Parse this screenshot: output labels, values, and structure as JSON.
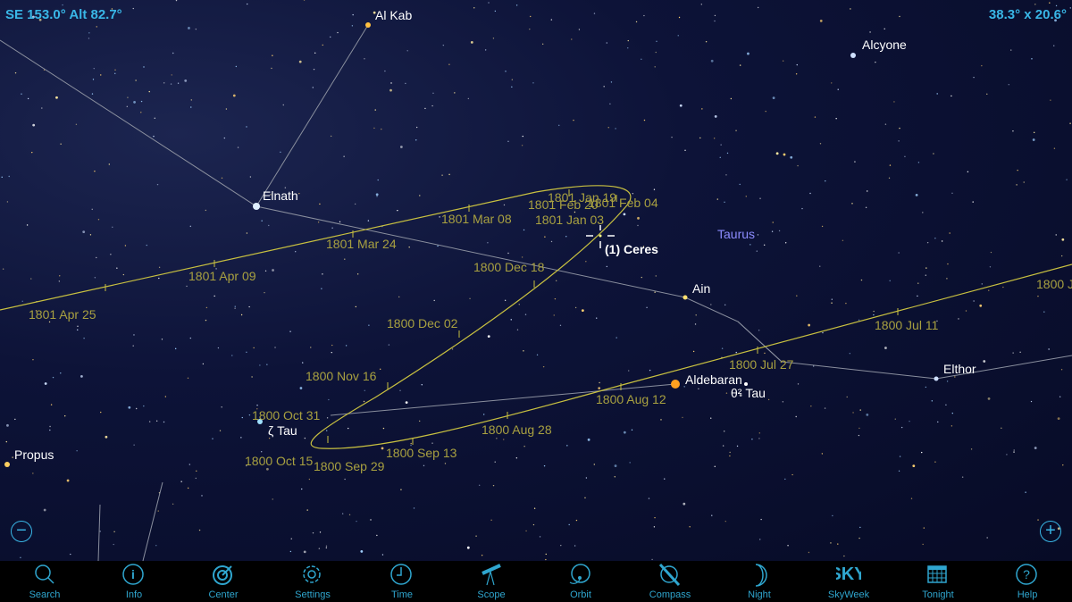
{
  "hud": {
    "direction": "SE 153.0° Alt 82.7°",
    "fov": "38.3° x 20.6°"
  },
  "colors": {
    "accent": "#39b6e6",
    "path": "#c8c040",
    "date_label": "#a8a040",
    "star_label": "#ffffff",
    "constellation_label": "#8c8cff"
  },
  "stars": [
    {
      "name": "Al Kab"
    },
    {
      "name": "Alcyone"
    },
    {
      "name": "Elnath"
    },
    {
      "name": "Ain"
    },
    {
      "name": "Aldebaran"
    },
    {
      "name": "θ² Tau"
    },
    {
      "name": "Elthor"
    },
    {
      "name": "ζ Tau"
    },
    {
      "name": "Propus"
    }
  ],
  "constellation": "Taurus",
  "object": "(1) Ceres",
  "dates": [
    "1801 Jan 19",
    "1801 Feb 20",
    "1801 Feb 04",
    "1801 Jan 03",
    "1801 Mar 08",
    "1801 Mar 24",
    "1801 Apr 09",
    "1801 Apr 25",
    "1800 Dec 18",
    "1800 Dec 02",
    "1800 Nov 16",
    "1800 Oct 31",
    "1800 Oct 15",
    "1800 Sep 29",
    "1800 Sep 13",
    "1800 Aug 28",
    "1800 Aug 12",
    "1800 Jul 27",
    "1800 Jul 11",
    "1800 J"
  ],
  "zoom": {
    "out": "−",
    "in": "+"
  },
  "toolbar": [
    {
      "label": "Search",
      "icon": "search-icon"
    },
    {
      "label": "Info",
      "icon": "info-icon"
    },
    {
      "label": "Center",
      "icon": "target-icon"
    },
    {
      "label": "Settings",
      "icon": "gear-icon"
    },
    {
      "label": "Time",
      "icon": "clock-icon"
    },
    {
      "label": "Scope",
      "icon": "telescope-icon"
    },
    {
      "label": "Orbit",
      "icon": "orbit-icon"
    },
    {
      "label": "Compass",
      "icon": "compass-icon"
    },
    {
      "label": "Night",
      "icon": "moon-icon"
    },
    {
      "label": "SkyWeek",
      "icon": "sky-telescope-logo",
      "logo": "SKY"
    },
    {
      "label": "Tonight",
      "icon": "calendar-icon"
    },
    {
      "label": "Help",
      "icon": "help-icon"
    }
  ]
}
